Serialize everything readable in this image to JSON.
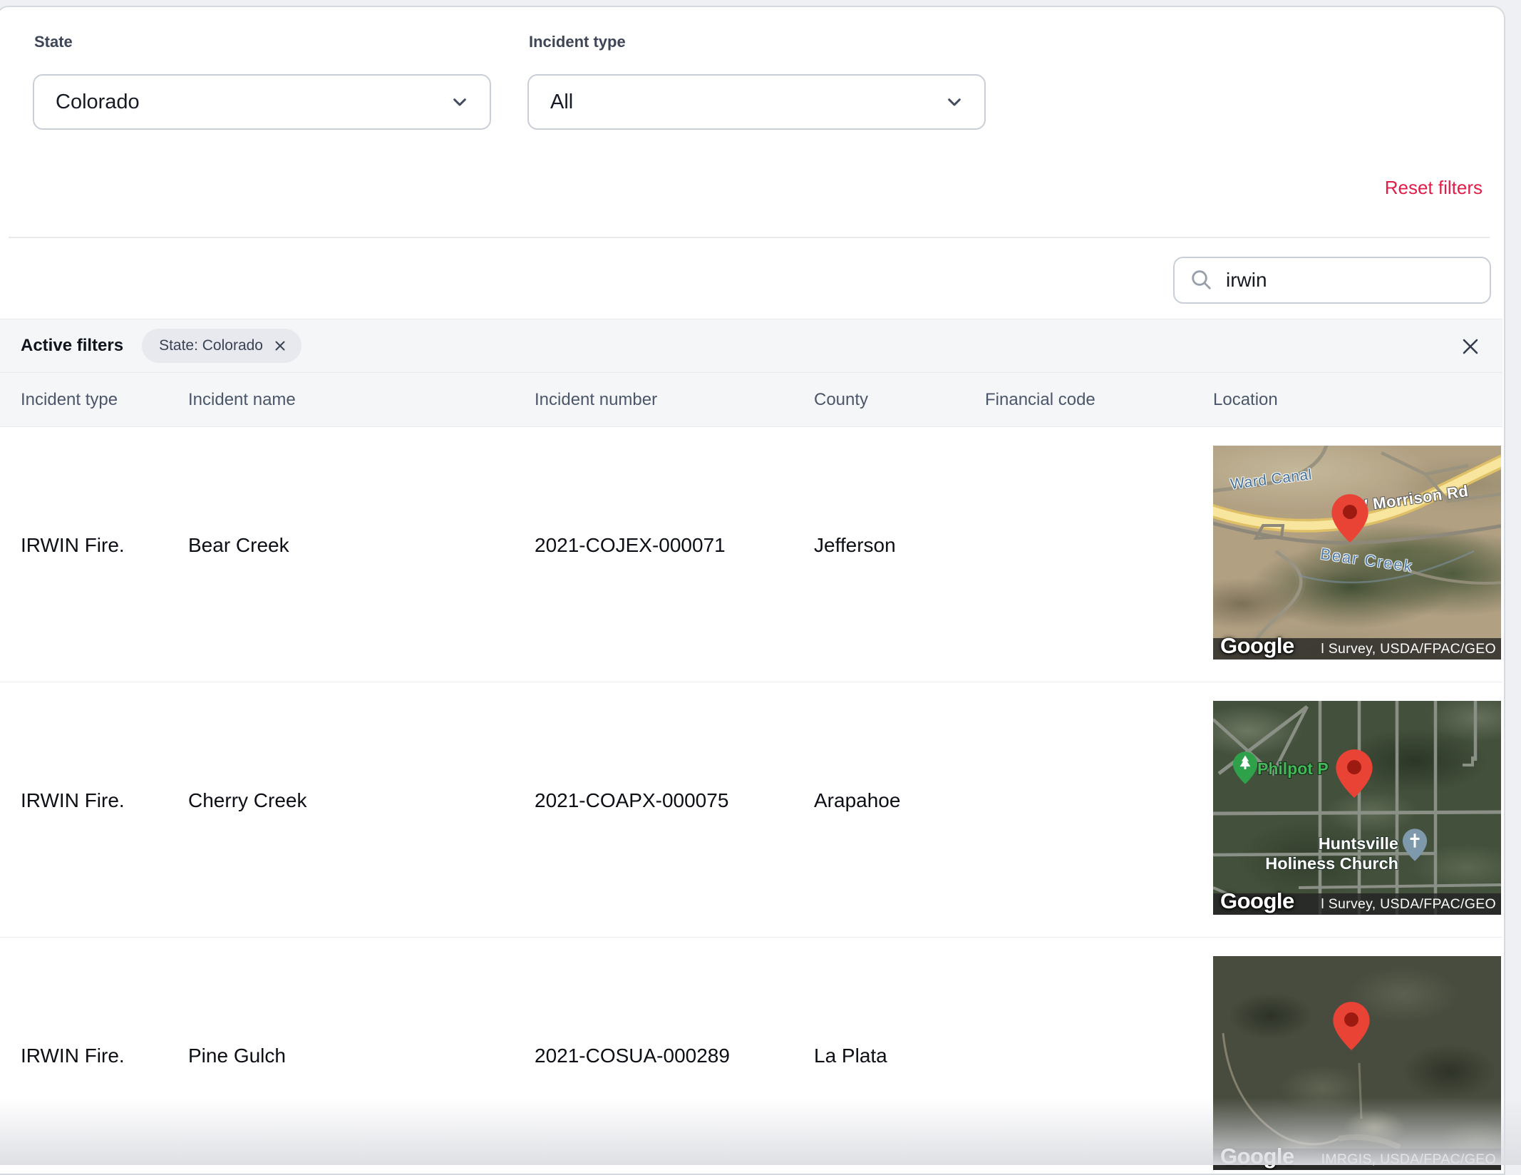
{
  "filters": {
    "state_label": "State",
    "state_value": "Colorado",
    "incident_type_label": "Incident type",
    "incident_type_value": "All",
    "reset_label": "Reset filters"
  },
  "search": {
    "value": "irwin"
  },
  "active_filters": {
    "label": "Active filters",
    "chips": [
      {
        "label": "State: Colorado"
      }
    ]
  },
  "table": {
    "columns": [
      "Incident type",
      "Incident name",
      "Incident number",
      "County",
      "Financial code",
      "Location"
    ],
    "rows": [
      {
        "incident_type": "IRWIN Fire.",
        "incident_name": "Bear Creek",
        "incident_number": "2021-COJEX-000071",
        "county": "Jefferson",
        "financial_code": "",
        "map": {
          "label_water": "Ward Canal",
          "label_road": "W Morrison Rd",
          "label_creek": "Bear Creek",
          "google_logo": "Google",
          "attribution": "l Survey, USDA/FPAC/GEO"
        }
      },
      {
        "incident_type": "IRWIN Fire.",
        "incident_name": "Cherry Creek",
        "incident_number": "2021-COAPX-000075",
        "county": "Arapahoe",
        "financial_code": "",
        "map": {
          "label_park": "Philpot P",
          "label_church": "Huntsville Holiness Church",
          "google_logo": "Google",
          "attribution": "l Survey, USDA/FPAC/GEO"
        }
      },
      {
        "incident_type": "IRWIN Fire.",
        "incident_name": "Pine Gulch",
        "incident_number": "2021-COSUA-000289",
        "county": "La Plata",
        "financial_code": "",
        "map": {
          "google_logo": "Google",
          "attribution": "IMRGIS, USDA/FPAC/GEO"
        }
      }
    ]
  },
  "colors": {
    "accent_red": "#e11d48",
    "pin_red": "#e94335",
    "pin_inner_red": "#9c1a10",
    "park_green": "#2fa14b",
    "church_pin_blue": "#7e99ac",
    "bar_bg": "#f5f6f8",
    "border": "#c9ced7"
  }
}
